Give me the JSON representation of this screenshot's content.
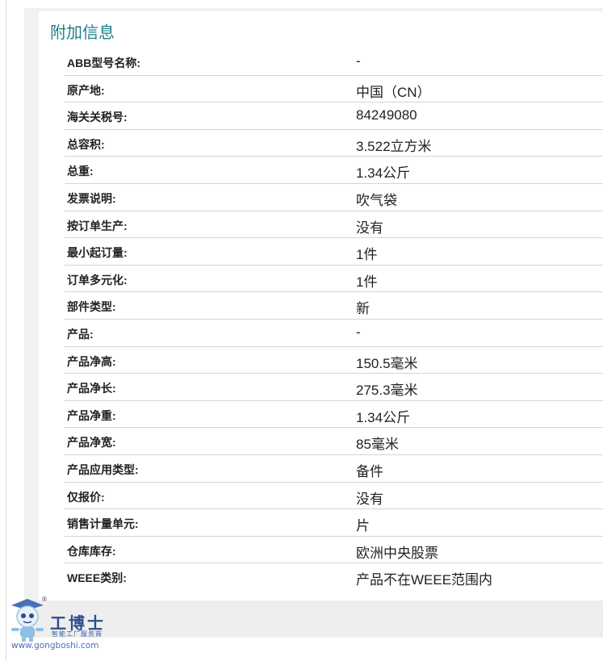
{
  "section": {
    "title": "附加信息"
  },
  "rows": [
    {
      "label": "ABB型号名称:",
      "value": "-"
    },
    {
      "label": "原产地:",
      "value": "中国（CN）"
    },
    {
      "label": "海关关税号:",
      "value": "84249080"
    },
    {
      "label": "总容积:",
      "value": "3.522立方米"
    },
    {
      "label": "总重:",
      "value": "1.34公斤"
    },
    {
      "label": "发票说明:",
      "value": "吹气袋"
    },
    {
      "label": "按订单生产:",
      "value": "没有"
    },
    {
      "label": "最小起订量:",
      "value": "1件"
    },
    {
      "label": "订单多元化:",
      "value": "1件"
    },
    {
      "label": "部件类型:",
      "value": "新"
    },
    {
      "label": "产品:",
      "value": "-"
    },
    {
      "label": "产品净高:",
      "value": "150.5毫米"
    },
    {
      "label": "产品净长:",
      "value": "275.3毫米"
    },
    {
      "label": "产品净重:",
      "value": "1.34公斤"
    },
    {
      "label": "产品净宽:",
      "value": "85毫米"
    },
    {
      "label": "产品应用类型:",
      "value": "备件"
    },
    {
      "label": "仅报价:",
      "value": "没有"
    },
    {
      "label": "销售计量单元:",
      "value": "片"
    },
    {
      "label": "仓库库存:",
      "value": "欧洲中央股票"
    },
    {
      "label": "WEEE类别:",
      "value": "产品不在WEEE范围内"
    }
  ],
  "watermark": {
    "brand": "工博士",
    "tagline": "智能工厂服务商",
    "url": "www.gongboshi.com",
    "registered": "®",
    "icon": "robot-mascot-icon"
  },
  "colors": {
    "title": "#1e7f8c",
    "panel_bg": "#f1f1f1",
    "divider": "#d4d4d4",
    "brand": "#2d4d8c"
  }
}
